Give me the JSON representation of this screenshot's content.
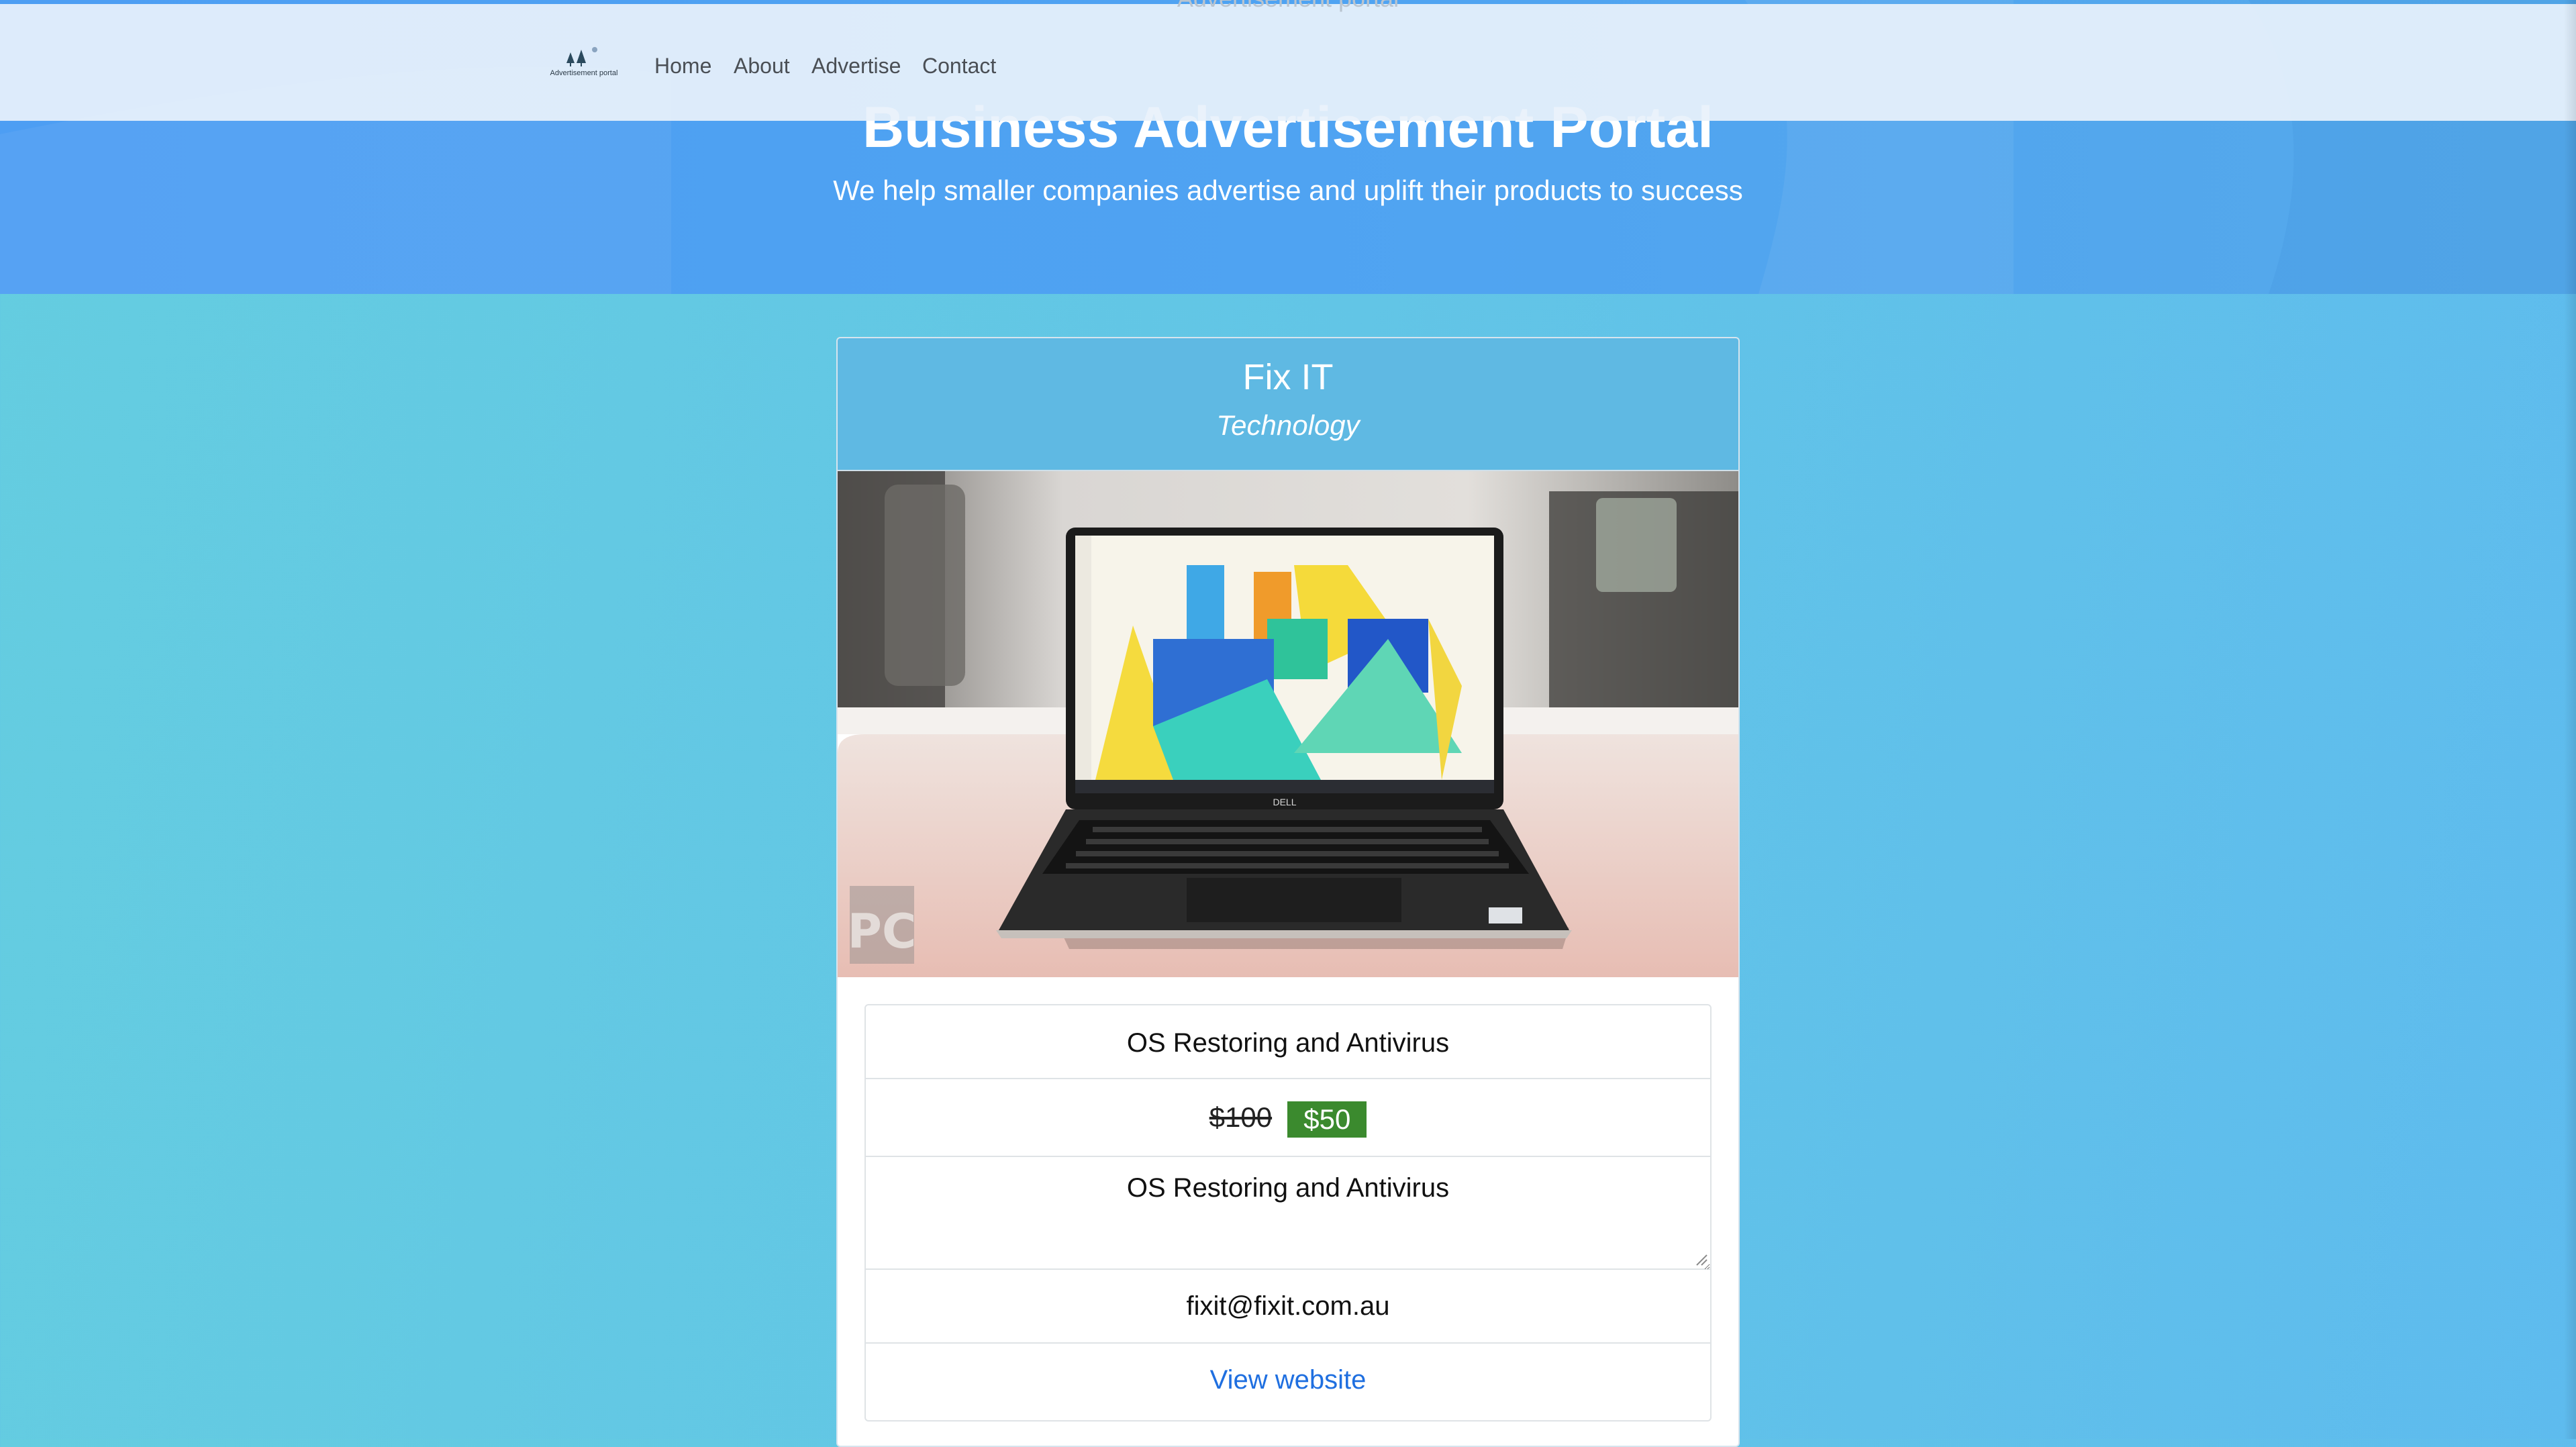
{
  "header": {
    "ghost_text": "Advertisement portal",
    "nav": {
      "logo_text": "Advertisement portal",
      "links": [
        "Home",
        "About",
        "Advertise",
        "Contact"
      ]
    },
    "title": "Business Advertisement Portal",
    "subtitle": "We help smaller companies advertise and uplift their products to success"
  },
  "card": {
    "name": "Fix IT",
    "category": "Technology",
    "image": {
      "subject": "laptop-on-desk",
      "brand_text": "DELL",
      "watermark_text": "PC"
    },
    "service": "OS Restoring and Antivirus",
    "old_price": "$100",
    "new_price": "$50",
    "description": "OS Restoring and Antivirus",
    "email": "fixit@fixit.com.au",
    "website_link": "View website"
  },
  "colors": {
    "hero": "#4fa3f2",
    "page_bg": "#62c5e6",
    "card_header": "#5fb9e3",
    "price_badge": "#3b8a2e",
    "link": "#1f6fe0"
  }
}
